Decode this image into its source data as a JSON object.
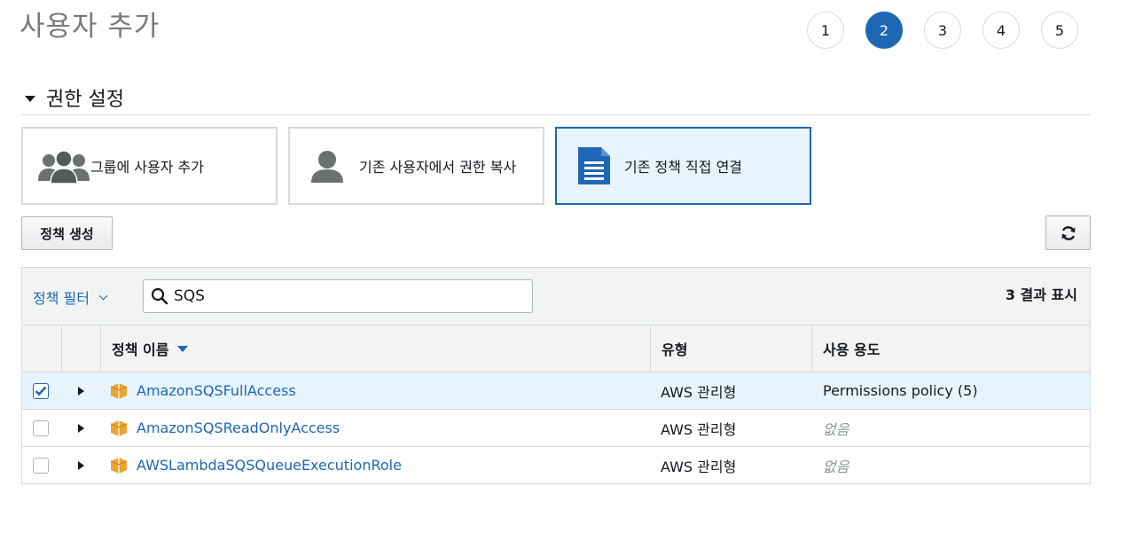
{
  "page": {
    "title": "사용자 추가"
  },
  "steps": [
    "1",
    "2",
    "3",
    "4",
    "5"
  ],
  "active_step": 2,
  "section": {
    "title": "권한 설정"
  },
  "options": [
    {
      "label": "그룹에 사용자 추가",
      "icon": "group-icon"
    },
    {
      "label": "기존 사용자에서 권한 복사",
      "icon": "user-icon"
    },
    {
      "label": "기존 정책 직접 연결",
      "icon": "document-icon",
      "selected": true
    }
  ],
  "toolbar": {
    "create_policy_label": "정책 생성",
    "refresh_icon": "refresh-icon"
  },
  "filter": {
    "label": "정책 필터",
    "search_value": "SQS",
    "result_count": "3 결과 표시"
  },
  "table": {
    "headers": {
      "name": "정책 이름",
      "type": "유형",
      "usage": "사용 용도"
    },
    "rows": [
      {
        "name": "AmazonSQSFullAccess",
        "type": "AWS 관리형",
        "usage": "Permissions policy (5)",
        "checked": true
      },
      {
        "name": "AmazonSQSReadOnlyAccess",
        "type": "AWS 관리형",
        "usage": "없음",
        "checked": false
      },
      {
        "name": "AWSLambdaSQSQueueExecutionRole",
        "type": "AWS 관리형",
        "usage": "없음",
        "checked": false
      }
    ]
  },
  "colors": {
    "accent": "#1f66b5",
    "selected_bg": "#e8f4fd",
    "policy_icon": "#f0a32f"
  }
}
